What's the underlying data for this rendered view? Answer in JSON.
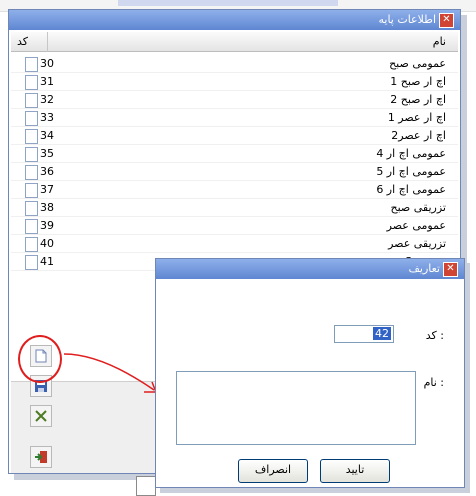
{
  "main": {
    "title": "اطلاعات پایه",
    "columns": {
      "code": "کد",
      "name": "نام"
    },
    "rows": [
      {
        "code": "30",
        "name": "عمومی صبح"
      },
      {
        "code": "31",
        "name": "اچ ار صبح 1"
      },
      {
        "code": "32",
        "name": "اچ ار صبح 2"
      },
      {
        "code": "33",
        "name": "اچ ار عصر 1"
      },
      {
        "code": "34",
        "name": "اچ ار عصر2"
      },
      {
        "code": "35",
        "name": "عمومی اچ ار 4"
      },
      {
        "code": "36",
        "name": "عمومی اچ ار 5"
      },
      {
        "code": "37",
        "name": "عمومی اچ ار 6"
      },
      {
        "code": "38",
        "name": "تزریقی صبح"
      },
      {
        "code": "39",
        "name": "عمومی عصر"
      },
      {
        "code": "40",
        "name": "تزریقی عصر"
      },
      {
        "code": "41",
        "name": "عمومی3"
      }
    ],
    "toolbar": [
      "new-document-icon",
      "save-icon",
      "delete-icon",
      "exit-icon"
    ]
  },
  "dialog": {
    "title": "تعاریف",
    "code_label": "کد :",
    "code_value": "42",
    "name_label": "نام :",
    "name_value": "",
    "ok_label": "تایید",
    "cancel_label": "انصراف"
  },
  "colors": {
    "titlebar": "#5f86d2",
    "highlight": "#e01e1e",
    "selection": "#3163c6"
  }
}
